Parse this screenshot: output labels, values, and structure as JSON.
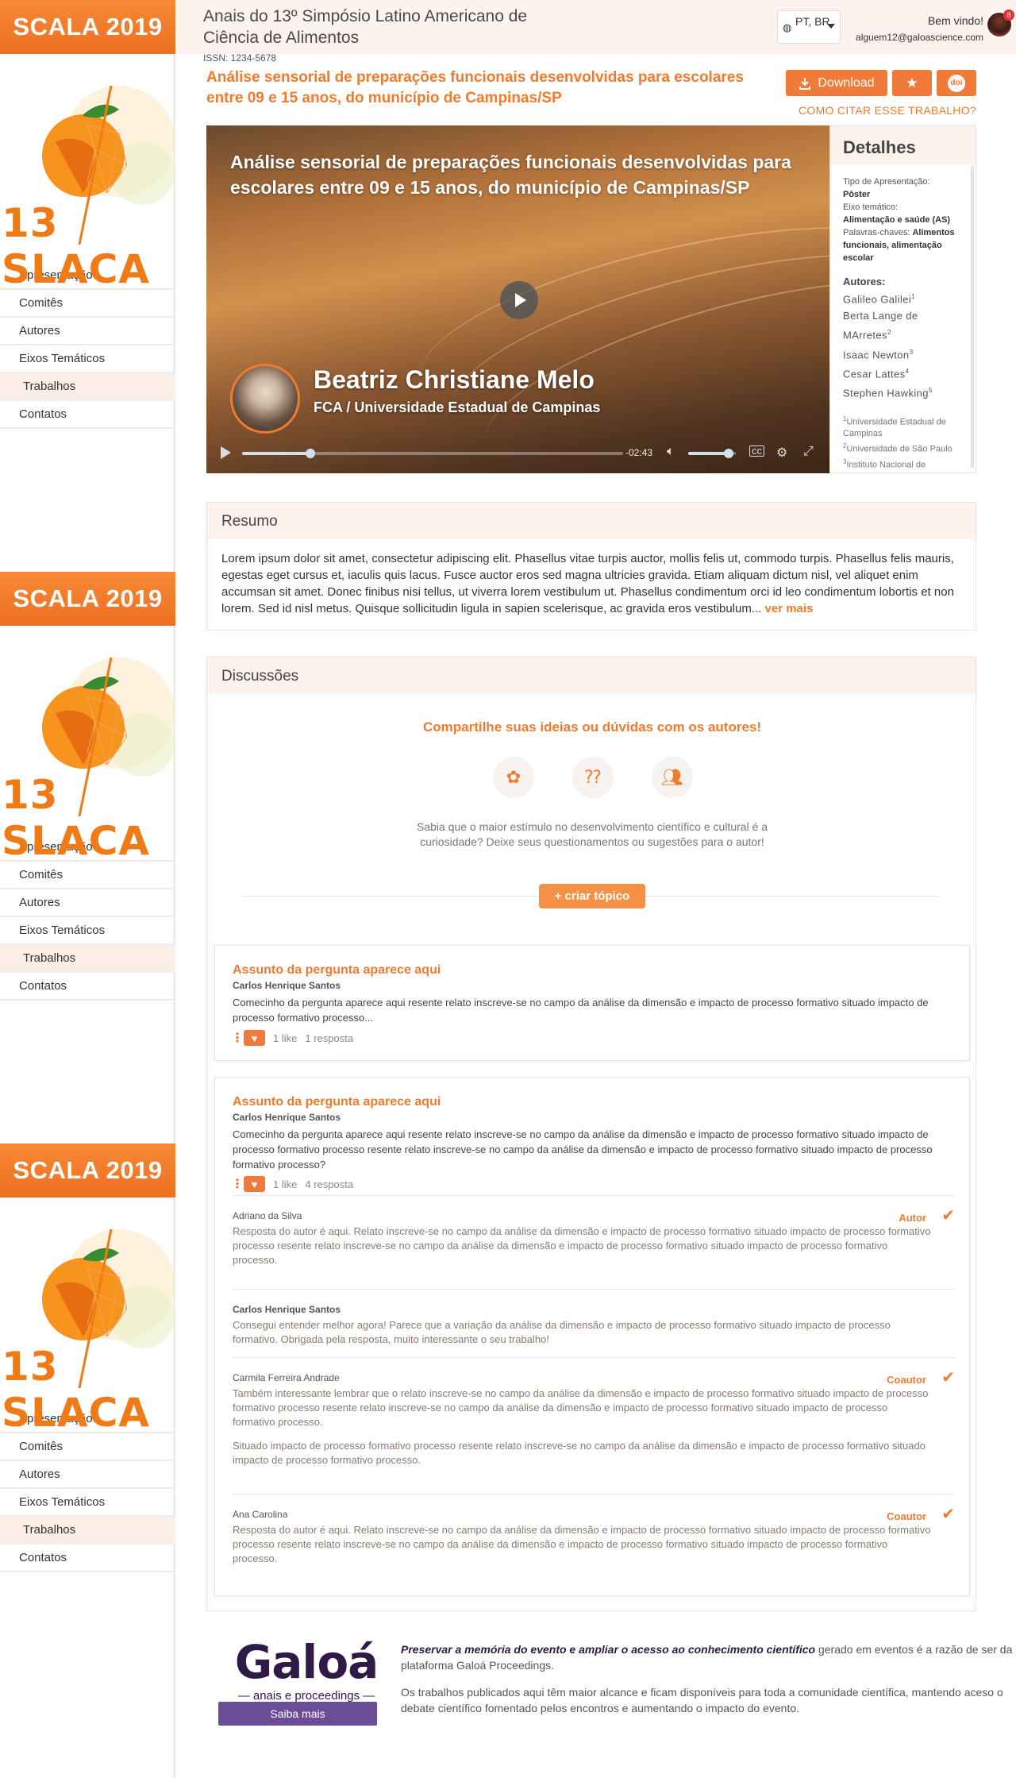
{
  "sidebar": {
    "banner": "SCALA 2019",
    "logo_text": "13 SLACA",
    "nav": [
      {
        "label": "Apresentação",
        "active": false
      },
      {
        "label": "Comitês",
        "active": false
      },
      {
        "label": "Autores",
        "active": false
      },
      {
        "label": "Eixos Temáticos",
        "active": false
      },
      {
        "label": "Trabalhos",
        "active": true
      },
      {
        "label": "Contatos",
        "active": false
      }
    ]
  },
  "header": {
    "title": "Anais do 13º Simpósio Latino Americano de Ciência de Alimentos",
    "issn": "ISSN: 1234-5678",
    "language": "PT, BR",
    "welcome": "Bem vindo!",
    "user_email": "alguem12@galoascience.com",
    "notification_count": "8"
  },
  "work": {
    "title": "Análise sensorial de preparações funcionais desenvolvidas para escolares entre 09 e 15 anos, do município de Campinas/SP",
    "download_label": "Download",
    "doi_label": "doi",
    "cite_link": "COMO CITAR ESSE TRABALHO?"
  },
  "video": {
    "title": "Análise sensorial de preparações funcionais desenvolvidas para escolares entre 09 e 15 anos, do município de Campinas/SP",
    "presenter_name": "Beatriz Christiane Melo",
    "presenter_affiliation": "FCA / Universidade Estadual de Campinas",
    "time_remaining": "-02:43",
    "progress": 0.18,
    "volume": 0.85
  },
  "details": {
    "heading": "Detalhes",
    "type_label": "Tipo de Apresentação:",
    "type_value": "Pôster",
    "axis_label": "Eixo temático:",
    "axis_value": "Alimentação e saúde (AS)",
    "keywords_label": "Palavras-chaves:",
    "keywords_value": "Alimentos funcionais, alimentação escolar",
    "authors_heading": "Autores:",
    "authors": [
      {
        "name": "Galileo Galilei",
        "sup": "1"
      },
      {
        "name": "Berta Lange de MArretes",
        "sup": "2"
      },
      {
        "name": "Isaac Newton",
        "sup": "3"
      },
      {
        "name": "Cesar Lattes",
        "sup": "4"
      },
      {
        "name": "Stephen Hawking",
        "sup": "5"
      }
    ],
    "institutions": [
      {
        "sup": "1",
        "name": "Universidade Estadual de Campinas"
      },
      {
        "sup": "2",
        "name": "Universidade de São Paulo"
      },
      {
        "sup": "3",
        "name": "Instituto Nacional de Pesquisas Espaciais"
      }
    ]
  },
  "resumo": {
    "heading": "Resumo",
    "text": "Lorem ipsum dolor sit amet, consectetur adipiscing elit. Phasellus vitae turpis auctor, mollis felis ut, commodo turpis. Phasellus felis mauris, egestas eget cursus et, iaculis quis lacus. Fusce auctor eros sed magna ultricies gravida. Etiam aliquam dictum nisl, vel aliquet enim accumsan sit amet. Donec finibus nisi tellus, ut viverra lorem vestibulum ut. Phasellus condimentum orci id leo condimentum lobortis et non lorem. Sed id nisl metus. Quisque sollicitudin ligula in sapien scelerisque, ac gravida eros vestibulum...",
    "more_label": "ver mais"
  },
  "discussions": {
    "heading": "Discussões",
    "cta": "Compartilhe suas ideias ou dúvidas com os autores!",
    "info": "Sabia que o maior estímulo no desenvolvimento científico e cultural é a curiosidade? Deixe seus questionamentos ou sugestões para o autor!",
    "create_topic_label": "criar tópico",
    "topics": [
      {
        "title": "Assunto da pergunta aparece aqui",
        "author": "Carlos Henrique Santos",
        "text": "Comecinho da pergunta aparece aqui resente relato inscreve-se no campo da análise da dimensão e impacto de processo formativo situado impacto de processo formativo processo...",
        "likes": "1 like",
        "replies": "1 resposta"
      },
      {
        "title": "Assunto da pergunta aparece aqui",
        "author": "Carlos Henrique Santos",
        "text": "Comecinho da pergunta aparece aqui resente relato inscreve-se no campo da análise da dimensão e impacto de processo formativo situado impacto de processo formativo processo resente relato inscreve-se no campo da análise da dimensão e impacto de processo formativo situado impacto de processo formativo processo?",
        "likes": "1 like",
        "replies": "4 resposta",
        "answers": [
          {
            "author": "Adriano da Silva",
            "role": "Autor",
            "text": "Resposta do autor é aqui. Relato inscreve-se no campo da análise da dimensão e impacto de processo formativo situado impacto de processo formativo processo resente relato inscreve-se no campo da análise da dimensão e impacto de processo formativo situado impacto de processo formativo processo."
          },
          {
            "author": "Carlos Henrique Santos",
            "role": "",
            "text": "Consegui entender melhor agora! Parece que a variação da análise da dimensão e impacto de processo formativo situado impacto de processo formativo. Obrigada pela resposta, muito interessante o seu trabalho!"
          },
          {
            "author": "Carmila Ferreira Andrade",
            "role": "Coautor",
            "text": "Também interessante lembrar que o relato inscreve-se no campo da análise da dimensão e impacto de processo formativo situado impacto de processo formativo processo resente relato inscreve-se no campo da análise da dimensão e impacto de processo formativo situado impacto de processo formativo processo.",
            "text2": "Situado impacto de processo formativo processo resente relato inscreve-se no campo da análise da dimensão e impacto de processo formativo situado impacto de processo formativo processo."
          },
          {
            "author": "Ana Carolina",
            "role": "Coautor",
            "text": "Resposta do autor é aqui. Relato inscreve-se no campo da análise da dimensão e impacto de processo formativo situado impacto de processo formativo processo resente relato inscreve-se no campo da análise da dimensão e impacto de processo formativo situado impacto de processo formativo processo."
          }
        ]
      }
    ]
  },
  "footer": {
    "brand": "Galoá",
    "brand_sub": "anais e proceedings",
    "cta": "Saiba mais",
    "p1_bold": "Preservar a memória do evento e ampliar o acesso ao conhecimento científico",
    "p1_rest": " gerado em eventos é a razão de ser da plataforma Galoá Proceedings.",
    "p2": "Os trabalhos publicados aqui têm maior alcance e ficam disponíveis para toda a comunidade científica, mantendo aceso o debate científico fomentado pelos encontros e aumentando o impacto do evento."
  },
  "colors": {
    "accent": "#f07a2e",
    "banner": "#f07a2e",
    "brand": "#2e1947",
    "header_bg": "#fdf3ee"
  }
}
